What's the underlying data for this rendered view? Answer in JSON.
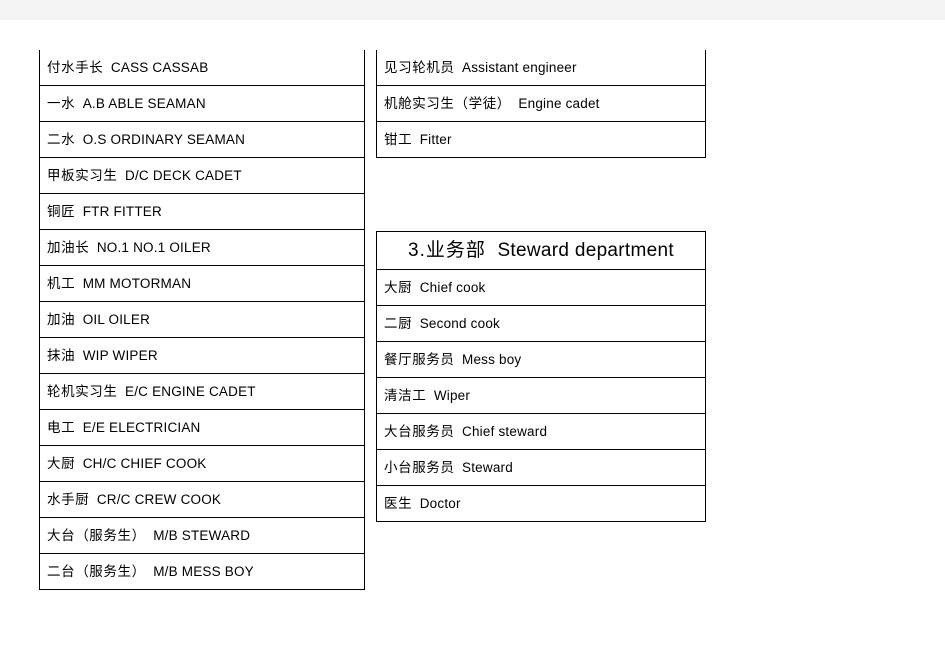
{
  "page": {
    "background_color": "#ffffff",
    "top_band_color": "#f3f3f3",
    "text_color": "#000000",
    "border_color": "#000000"
  },
  "tables": {
    "deck_engine_ranks": {
      "name": "deck-and-engine-ranks-continued",
      "continued_from_previous": true,
      "rows": [
        {
          "cn": "付水手长",
          "en": "CASS CASSAB"
        },
        {
          "cn": "一水",
          "en": "A.B ABLE SEAMAN"
        },
        {
          "cn": "二水",
          "en": "O.S ORDINARY SEAMAN"
        },
        {
          "cn": "甲板实习生",
          "en": "D/C DECK CADET"
        },
        {
          "cn": "铜匠",
          "en": "FTR FITTER"
        },
        {
          "cn": "加油长",
          "en": "NO.1 NO.1 OILER"
        },
        {
          "cn": "机工",
          "en": "MM MOTORMAN"
        },
        {
          "cn": "加油",
          "en": "OIL OILER"
        },
        {
          "cn": "抹油",
          "en": "WIP WIPER"
        },
        {
          "cn": "轮机实习生",
          "en": "E/C ENGINE CADET"
        },
        {
          "cn": "电工",
          "en": "E/E ELECTRICIAN"
        },
        {
          "cn": "大厨",
          "en": "CH/C CHIEF COOK"
        },
        {
          "cn": "水手厨",
          "en": "CR/C CREW COOK"
        },
        {
          "cn": "大台（服务生）",
          "en": "M/B STEWARD"
        },
        {
          "cn": "二台（服务生）",
          "en": "M/B MESS BOY"
        }
      ]
    },
    "engine_continued": {
      "name": "engine-department-ranks-continued",
      "continued_from_previous": true,
      "rows": [
        {
          "cn": "见习轮机员",
          "en": "Assistant engineer"
        },
        {
          "cn": "机舱实习生（学徒）",
          "en": "Engine cadet"
        },
        {
          "cn": "钳工",
          "en": "Fitter"
        }
      ]
    },
    "steward_department": {
      "name": "steward-department",
      "title": {
        "cn": "3.业务部",
        "en": "Steward department"
      },
      "rows": [
        {
          "cn": "大厨",
          "en": "Chief cook"
        },
        {
          "cn": "二厨",
          "en": "Second cook"
        },
        {
          "cn": "餐厅服务员",
          "en": "Mess boy"
        },
        {
          "cn": "清洁工",
          "en": "Wiper"
        },
        {
          "cn": "大台服务员",
          "en": "Chief steward"
        },
        {
          "cn": "小台服务员",
          "en": "Steward"
        },
        {
          "cn": "医生",
          "en": "Doctor"
        }
      ]
    }
  }
}
